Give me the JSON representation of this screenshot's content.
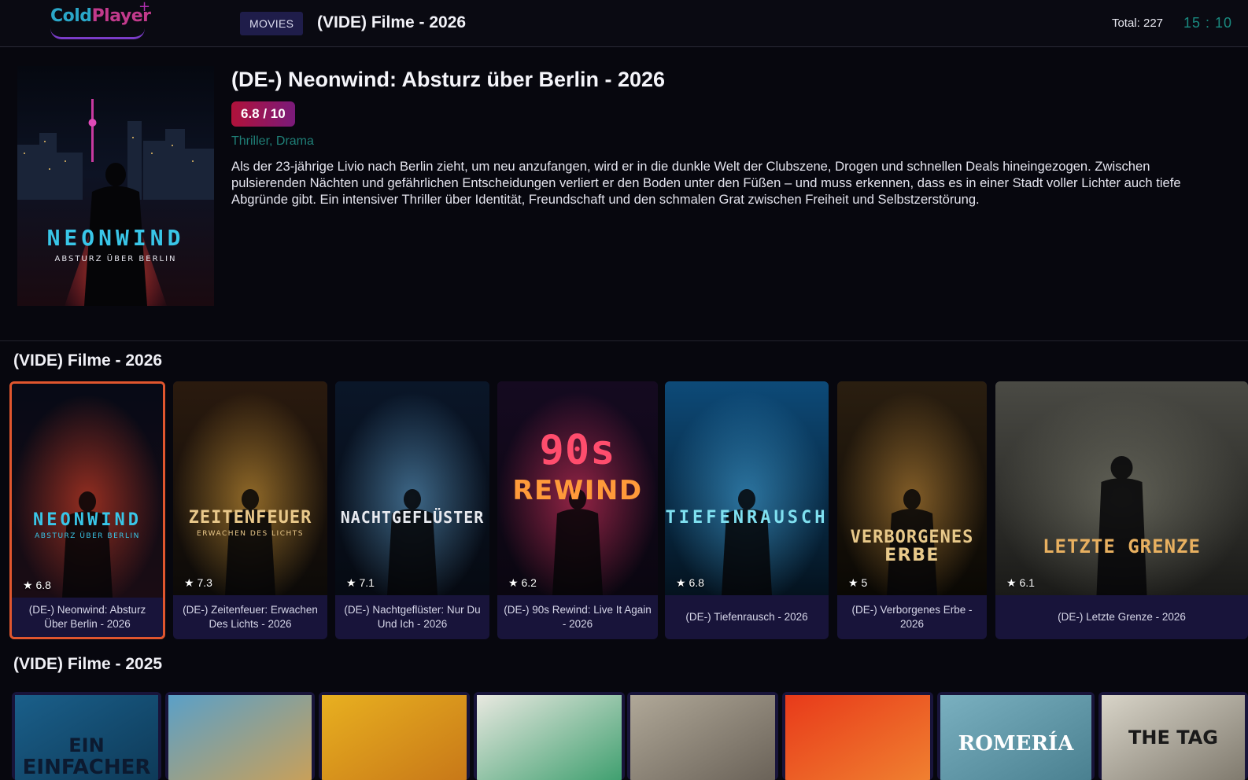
{
  "header": {
    "logo_cold": "Cold",
    "logo_player": "Player",
    "logo_plus": "+",
    "section_pill": "MOVIES",
    "category_title": "(VIDE) Filme - 2026",
    "total": "Total: 227",
    "clock": "15 : 10"
  },
  "hero": {
    "title": "(DE-) Neonwind: Absturz über Berlin - 2026",
    "rating": "6.8 / 10",
    "genres": "Thriller, Drama",
    "description": "Als der 23-jährige Livio nach Berlin zieht, um neu anzufangen, wird er in die dunkle Welt der Clubszene, Drogen und schnellen Deals hineingezogen. Zwischen pulsierenden Nächten und gefährlichen Entscheidungen verliert er den Boden unter den Füßen – und muss erkennen, dass es in einer Stadt voller Lichter auch tiefe Abgründe gibt. Ein intensiver Thriller über Identität, Freundschaft und den schmalen Grat zwischen Freiheit und Selbstzerstörung.",
    "poster_title": "NEONWIND",
    "poster_subtitle": "ABSTURZ ÜBER BERLIN"
  },
  "rows": [
    {
      "title": "(VIDE) Filme - 2026",
      "items": [
        {
          "label": "(DE-) Neonwind: Absturz Über Berlin - 2026",
          "rating": "★ 6.8",
          "poster_text": "NEONWIND",
          "poster_sub": "ABSTURZ ÜBER BERLIN",
          "accent": "#39c6e8"
        },
        {
          "label": "(DE-) Zeitenfeuer: Erwachen Des Lichts - 2026",
          "rating": "★ 7.3",
          "poster_text": "ZEITENFEUER",
          "poster_sub": "ERWACHEN DES LICHTS",
          "accent": "#e9c88a"
        },
        {
          "label": "(DE-) Nachtgeflüster: Nur Du Und Ich - 2026",
          "rating": "★ 7.1",
          "poster_text": "NACHTGEFLÜSTER",
          "poster_sub": "",
          "accent": "#e8eaf0"
        },
        {
          "label": "(DE-) 90s Rewind: Live It Again - 2026",
          "rating": "★ 6.2",
          "poster_text": "90s",
          "poster_sub": "REWIND",
          "accent": "#ff4d6d"
        },
        {
          "label": "(DE-) Tiefenrausch - 2026",
          "rating": "★ 6.8",
          "poster_text": "TIEFENRAUSCH",
          "poster_sub": "",
          "accent": "#7fe0f0"
        },
        {
          "label": "(DE-) Verborgenes Erbe - 2026",
          "rating": "★ 5",
          "poster_text": "VERBORGENES",
          "poster_sub": "ERBE",
          "accent": "#e8c98a"
        },
        {
          "label": "(DE-) Letzte Grenze - 2026",
          "rating": "★ 6.1",
          "poster_text": "LETZTE GRENZE",
          "poster_sub": "",
          "accent": "#e8b060"
        }
      ]
    },
    {
      "title": "(VIDE) Filme - 2025",
      "items": [
        {
          "poster_text": "EIN",
          "poster_sub": "EINFACHER"
        },
        {
          "poster_text": "",
          "poster_sub": ""
        },
        {
          "poster_text": "",
          "poster_sub": ""
        },
        {
          "poster_text": "",
          "poster_sub": ""
        },
        {
          "poster_text": "",
          "poster_sub": ""
        },
        {
          "poster_text": "",
          "poster_sub": ""
        },
        {
          "poster_text": "ROMERÍA",
          "poster_sub": ""
        },
        {
          "poster_text": "THE TAG",
          "poster_sub": ""
        }
      ]
    }
  ]
}
